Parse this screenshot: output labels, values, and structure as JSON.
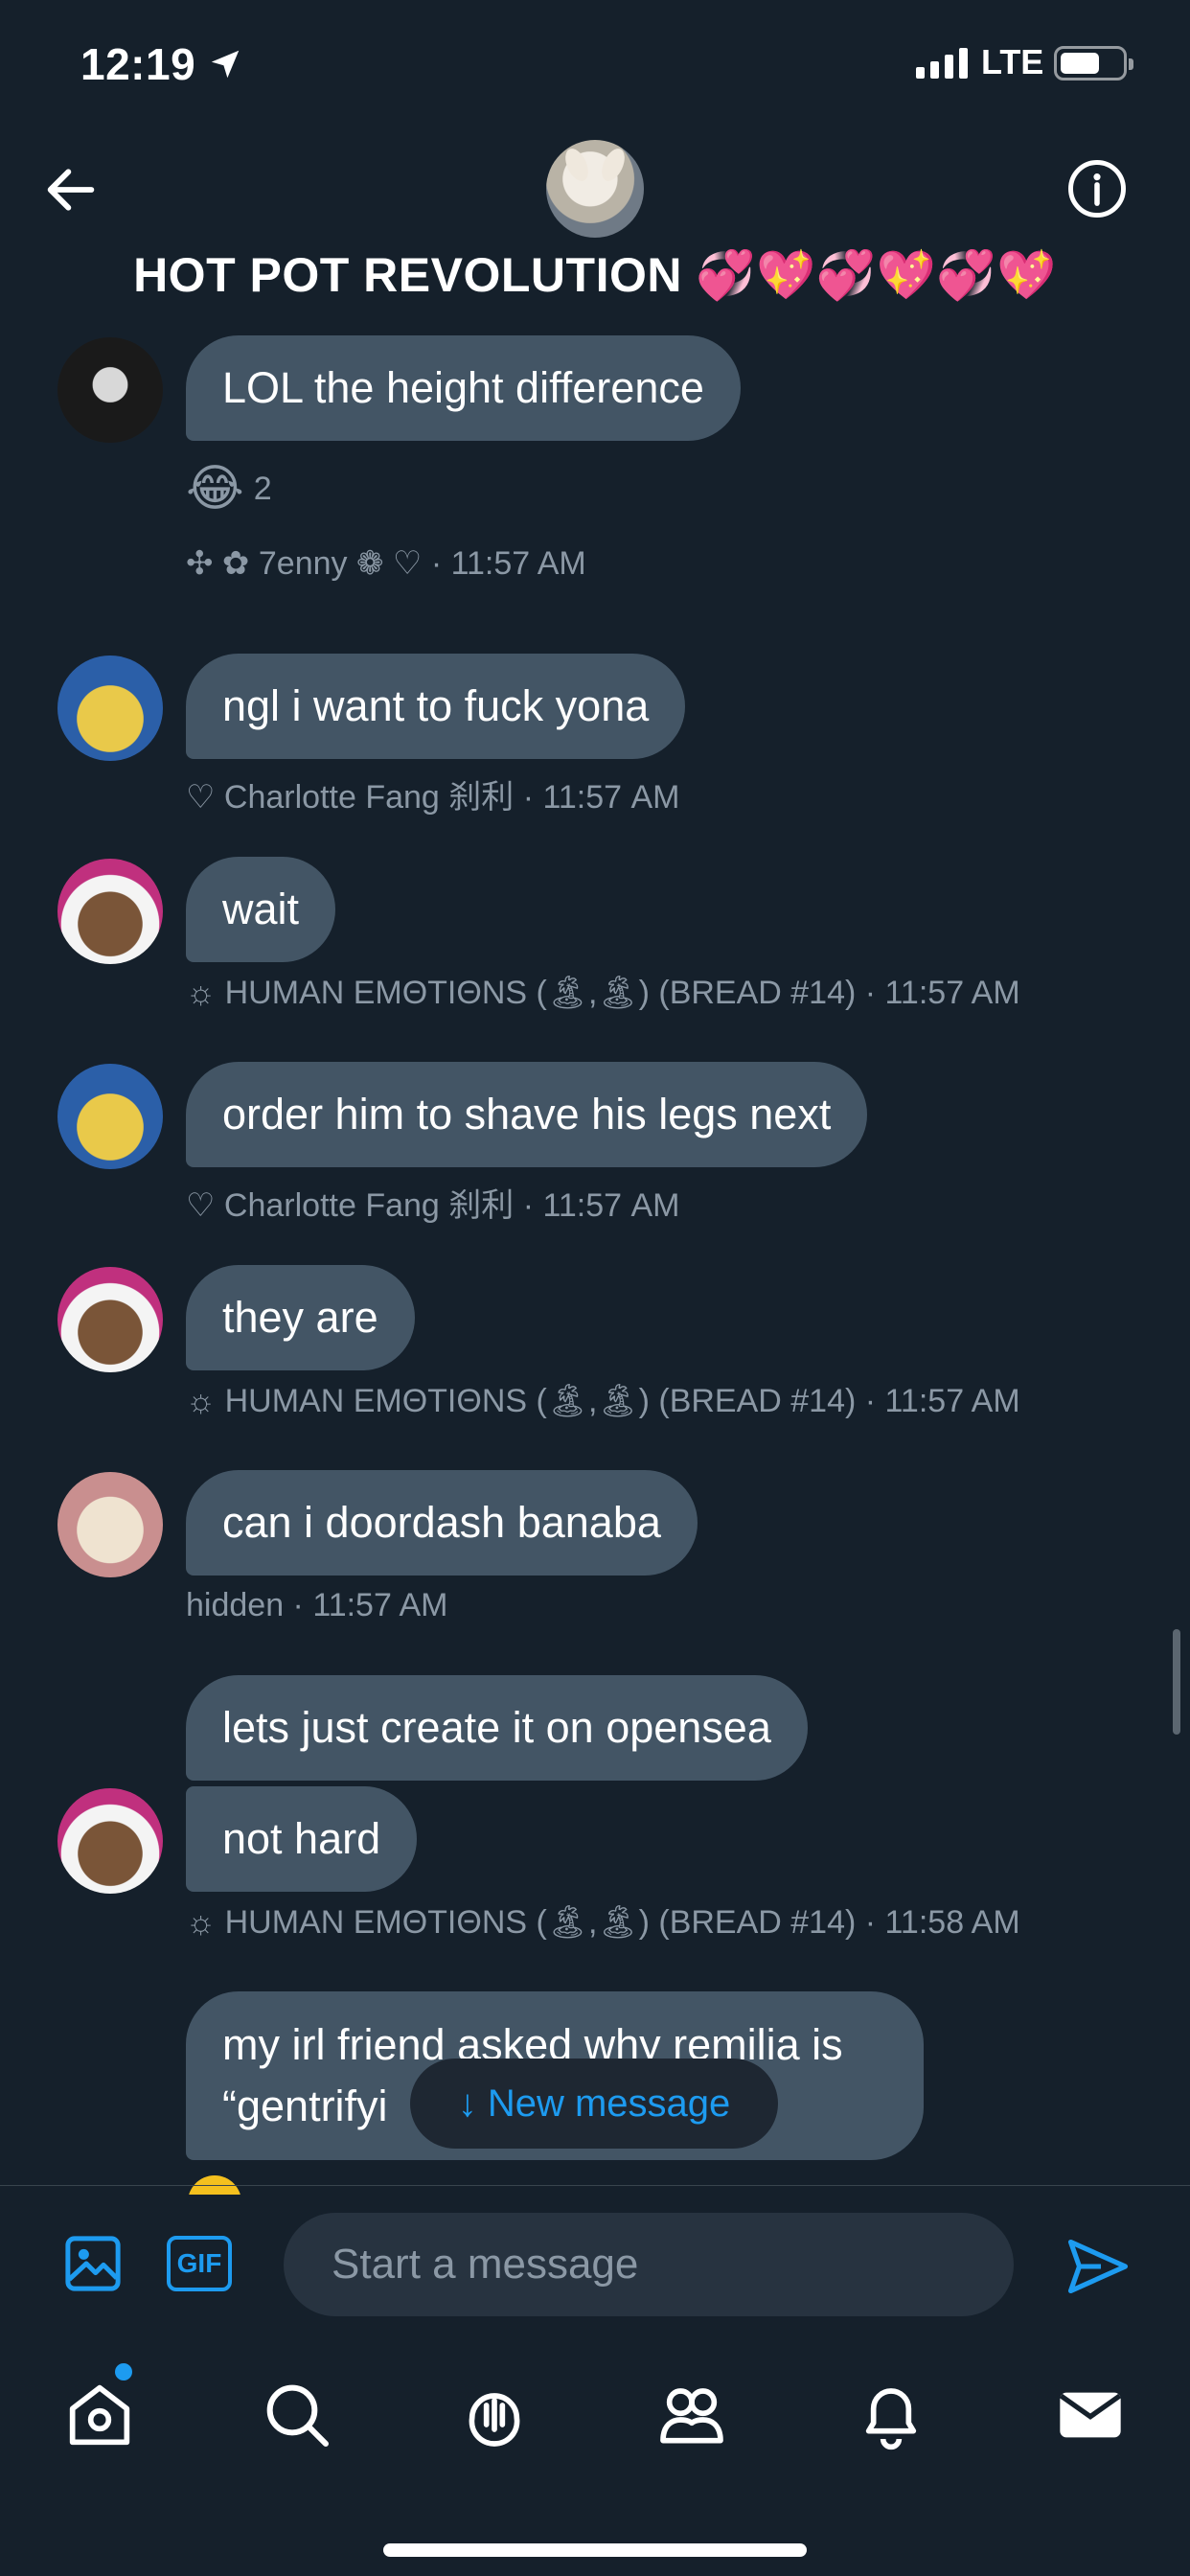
{
  "status_bar": {
    "time": "12:19",
    "network": "LTE"
  },
  "header": {
    "title": "HOT POT REVOLUTION 💞💖💞💖💞💖"
  },
  "messages": [
    {
      "text": "LOL the height difference",
      "reaction_emoji": "😂",
      "reaction_count": "2",
      "meta": "✣ ✿ 7enny ❁ ♡  · 11:57 AM"
    },
    {
      "text": "ngl i want to fuck yona",
      "meta": "♡ Charlotte Fang 刹利  · 11:57 AM"
    },
    {
      "text": "wait",
      "meta": "☼ HUMAN EMΘTIΘNS (🏝,🏝) (BREAD #14)  · 11:57 AM"
    },
    {
      "text": "order him to shave his legs next",
      "meta": "♡ Charlotte Fang 刹利  · 11:57 AM"
    },
    {
      "text": "they are",
      "meta": "☼ HUMAN EMΘTIΘNS (🏝,🏝) (BREAD #14)  · 11:57 AM"
    },
    {
      "text": "can i doordash banaba",
      "meta": "hidden  · 11:57 AM"
    },
    {
      "text": "lets just create it on opensea"
    },
    {
      "text": "not hard",
      "meta": "☼ HUMAN EMΘTIΘNS (🏝,🏝) (BREAD #14)  · 11:58 AM"
    },
    {
      "text": "my irl friend asked why remilia is “gentrifyi"
    }
  ],
  "new_message_label": "↓ New message",
  "composer": {
    "placeholder": "Start a message",
    "gif_label": "GIF"
  },
  "tabs": [
    "home",
    "search",
    "spaces",
    "communities",
    "notifications",
    "messages"
  ],
  "colors": {
    "background": "#15202b",
    "bubble": "#435565",
    "accent": "#1d9bf0",
    "meta": "#8b98a5"
  }
}
